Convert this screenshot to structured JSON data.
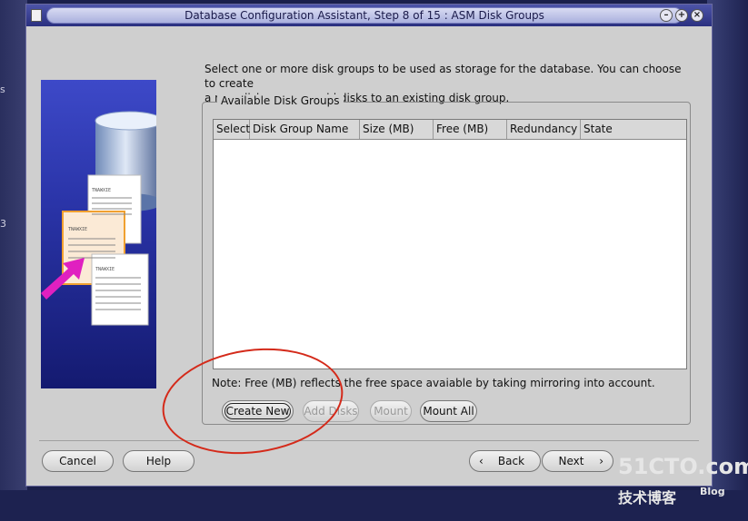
{
  "window": {
    "title": "Database Configuration Assistant, Step 8 of 15 : ASM Disk Groups"
  },
  "desktop": {
    "marks": [
      "s",
      "3"
    ]
  },
  "prompt": {
    "line1": "Select one or more disk groups to be used as storage for the database. You can choose to create",
    "line2": "a new disk group or add disks to an existing disk group."
  },
  "disk_groups": {
    "legend": "Available Disk Groups",
    "columns": [
      "Select",
      "Disk Group Name",
      "Size (MB)",
      "Free (MB)",
      "Redundancy",
      "State"
    ],
    "rows": []
  },
  "note": "Note: Free (MB) reflects the free space avaiable by taking mirroring into account.",
  "actions": {
    "create_new": "Create New",
    "add_disks": "Add Disks",
    "mount": "Mount",
    "mount_all": "Mount All"
  },
  "footer": {
    "cancel": "Cancel",
    "help": "Help",
    "back": "Back",
    "back_icon": "chevron-left-icon",
    "next": "Next",
    "next_icon": "chevron-right-icon"
  },
  "image_text": [
    "TNAWXIE",
    "TNAWXIE",
    "TNAWXIE"
  ],
  "watermark": {
    "line1": "51CTO.com",
    "line2": "技术博客",
    "line3": "Blog"
  },
  "colors": {
    "annotation_circle": "#d42a1a",
    "title_bar": "#2a3080",
    "panel_bg": "#cfcfcf"
  }
}
